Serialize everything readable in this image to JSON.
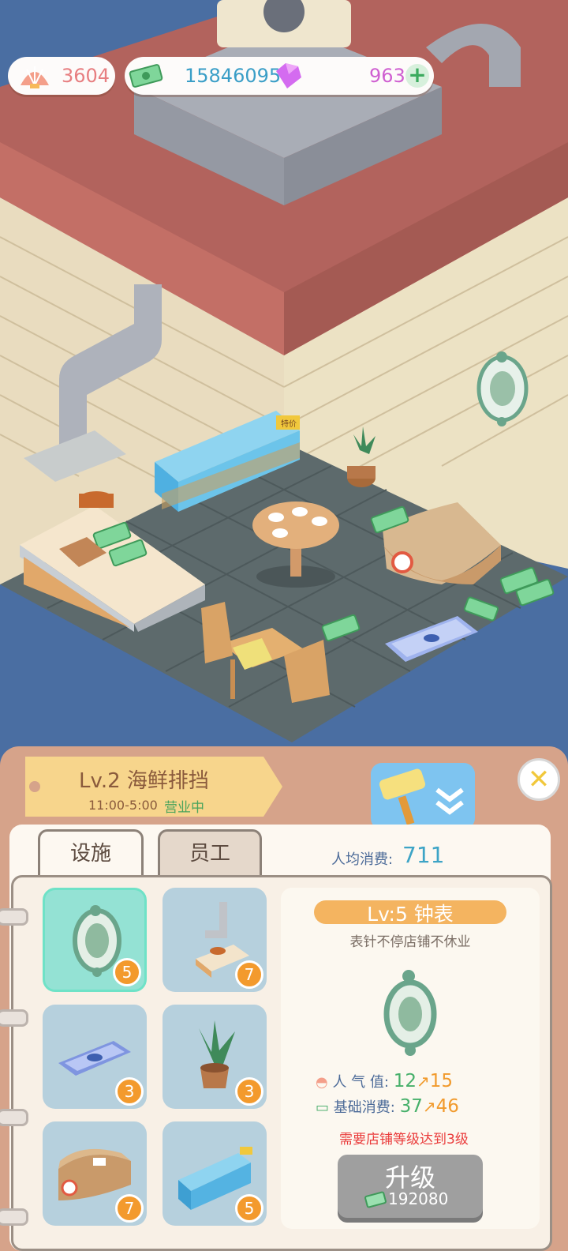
{
  "currency": {
    "shells": "3604",
    "cash": "15846095",
    "gems": "963",
    "add_symbol": "+"
  },
  "shop": {
    "title": "Lv.2 海鲜排挡",
    "hours": "11:00-5:00",
    "status": "营业中",
    "fish_tank_badge": "特价"
  },
  "tabs": [
    {
      "label": "设施",
      "selected": true
    },
    {
      "label": "员工",
      "selected": false
    }
  ],
  "avg_spend": {
    "label": "人均消费:",
    "value": "711"
  },
  "facilities": [
    {
      "icon": "clock-icon",
      "level": "5",
      "selected": true
    },
    {
      "icon": "vent-stove-icon",
      "level": "7"
    },
    {
      "icon": "fish-mat-icon",
      "level": "3"
    },
    {
      "icon": "potted-plant-icon",
      "level": "3"
    },
    {
      "icon": "counter-icon",
      "level": "7"
    },
    {
      "icon": "fish-tank-icon",
      "level": "5"
    }
  ],
  "detail": {
    "title": "Lv:5 钟表",
    "description": "表针不停店铺不休业",
    "popularity_label": "人 气 值:",
    "popularity_from": "12",
    "popularity_to": "15",
    "base_spend_label": "基础消费:",
    "base_spend_from": "37",
    "base_spend_to": "46",
    "requirement": "需要店铺等级达到3级",
    "upgrade_label": "升级",
    "upgrade_cost": "192080"
  },
  "colors": {
    "panel": "#d6a38a",
    "accent_orange": "#f39a2d",
    "teal": "#3da4c6"
  }
}
